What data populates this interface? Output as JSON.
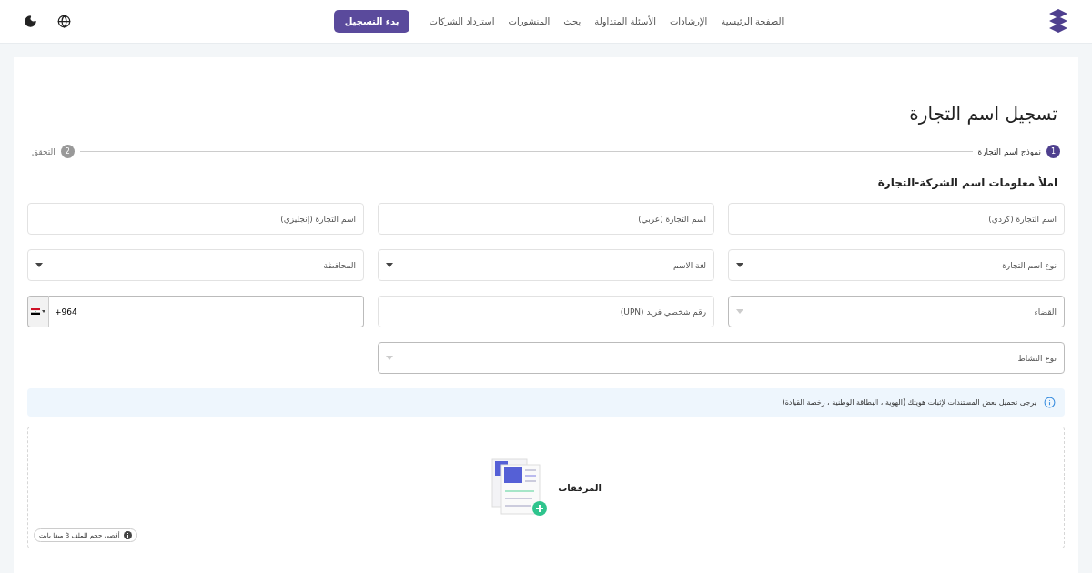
{
  "nav": {
    "items": [
      "الصفحة الرئيسية",
      "الإرشادات",
      "الأسئلة المتداولة",
      "بحث",
      "المنشورات",
      "استرداد الشركات"
    ],
    "cta": "بدء التسجيل"
  },
  "page_title": "تسجيل اسم التجارة",
  "steps": [
    {
      "number": "1",
      "label": "نموذج اسم التجارة",
      "selected": true
    },
    {
      "number": "2",
      "label": "التحقق",
      "selected": false
    }
  ],
  "section_title": "املأ معلومات اسم الشركة-التجارة",
  "fields": [
    {
      "kind": "text",
      "placeholder": "اسم التجارة (كردي)"
    },
    {
      "kind": "text",
      "placeholder": "اسم التجارة (عربي)"
    },
    {
      "kind": "text",
      "placeholder": "اسم التجارة (إنجليزي)"
    },
    {
      "kind": "select",
      "placeholder": "نوع اسم التجارة",
      "disabled": false
    },
    {
      "kind": "select",
      "placeholder": "لغة الاسم",
      "disabled": false
    },
    {
      "kind": "select",
      "placeholder": "المحافظة",
      "disabled": false
    },
    {
      "kind": "select",
      "placeholder": "القضاء",
      "disabled": true
    },
    {
      "kind": "text",
      "placeholder": "رقم شخصي فريد (UPN)"
    },
    {
      "kind": "phone",
      "value": "+964"
    },
    {
      "kind": "select",
      "placeholder": "نوع النشاط",
      "disabled": true,
      "wide": true
    }
  ],
  "notice": "يرجى تحميل بعض المستندات لإثبات هويتك (الهوية ، البطاقة الوطنية ، رخصة القيادة)",
  "upload": {
    "label": "المرفقات",
    "size_hint": "أقصى حجم للملف 3 ميغا بايت"
  }
}
